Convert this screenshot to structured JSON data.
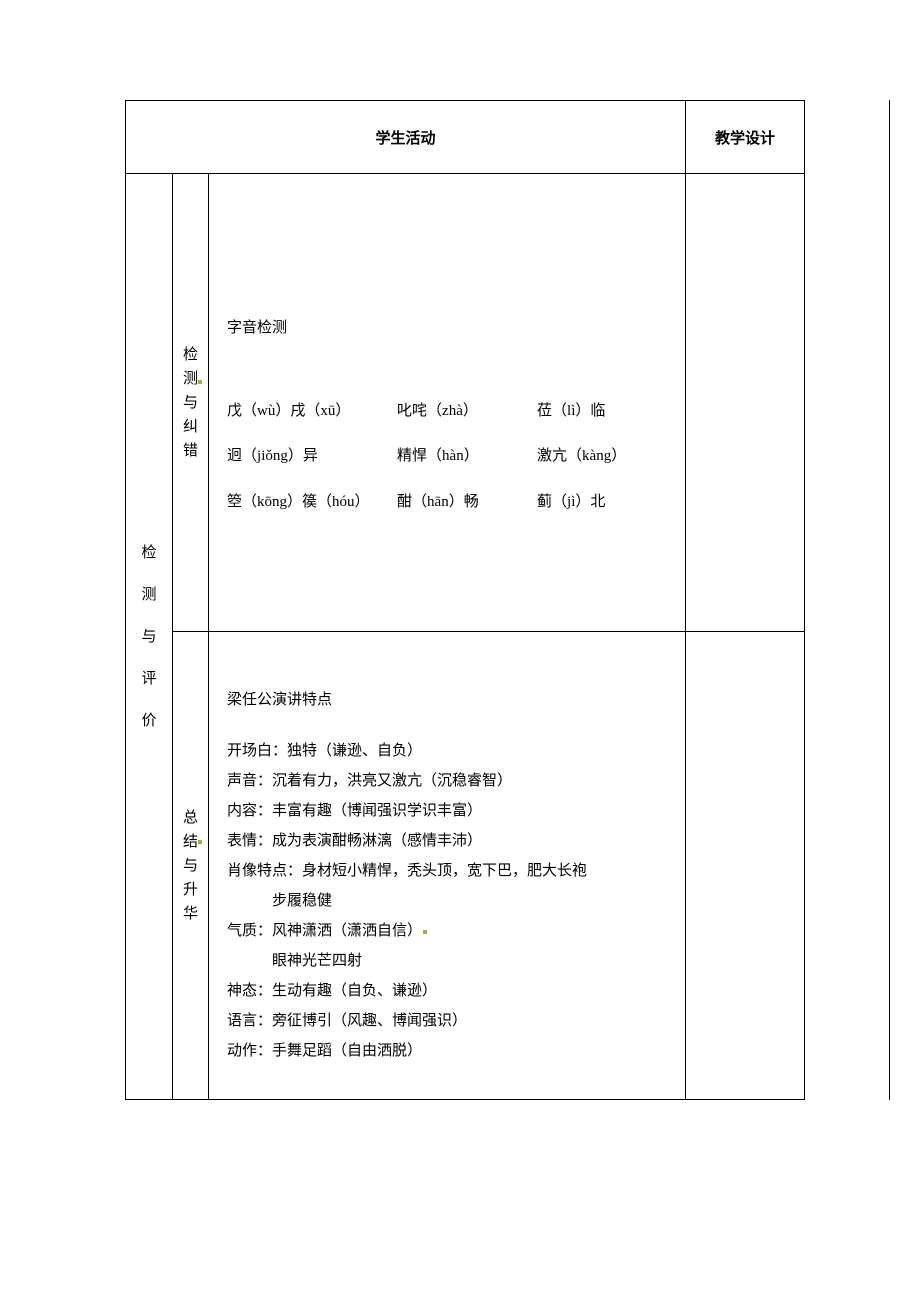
{
  "headers": {
    "activity": "学生活动",
    "design": "教学设计"
  },
  "leftLabel": "检　测　与　评　价",
  "section1": {
    "label": "检测与纠错",
    "title": "字音检测",
    "rows": [
      {
        "c1": "戊（wù）戌（xū）",
        "c2": "叱咤（zhà）",
        "c3": "莅（lì）临"
      },
      {
        "c1": "迥（jiǒng）异",
        "c2": "精悍（hàn）",
        "c3": "激亢（kàng）"
      },
      {
        "c1": "箜（kōng）篌（hóu）",
        "c2": "酣（hān）畅",
        "c3": "蓟（jì）北"
      }
    ]
  },
  "section2": {
    "label": "总结与升华",
    "title": "梁任公演讲特点",
    "lines": [
      "开场白：独特（谦逊、自负）",
      "声音：沉着有力，洪亮又激亢（沉稳睿智）",
      "内容：丰富有趣（博闻强识学识丰富）",
      "表情：成为表演酣畅淋漓（感情丰沛）",
      "肖像特点：身材短小精悍，秃头顶，宽下巴，肥大长袍",
      "　　　步履稳健",
      "气质：风神潇洒（潇洒自信）",
      "　　　眼神光芒四射",
      "神态：生动有趣（自负、谦逊）",
      "语言：旁征博引（风趣、博闻强识）",
      "动作：手舞足蹈（自由洒脱）"
    ],
    "xinPos": 13
  }
}
